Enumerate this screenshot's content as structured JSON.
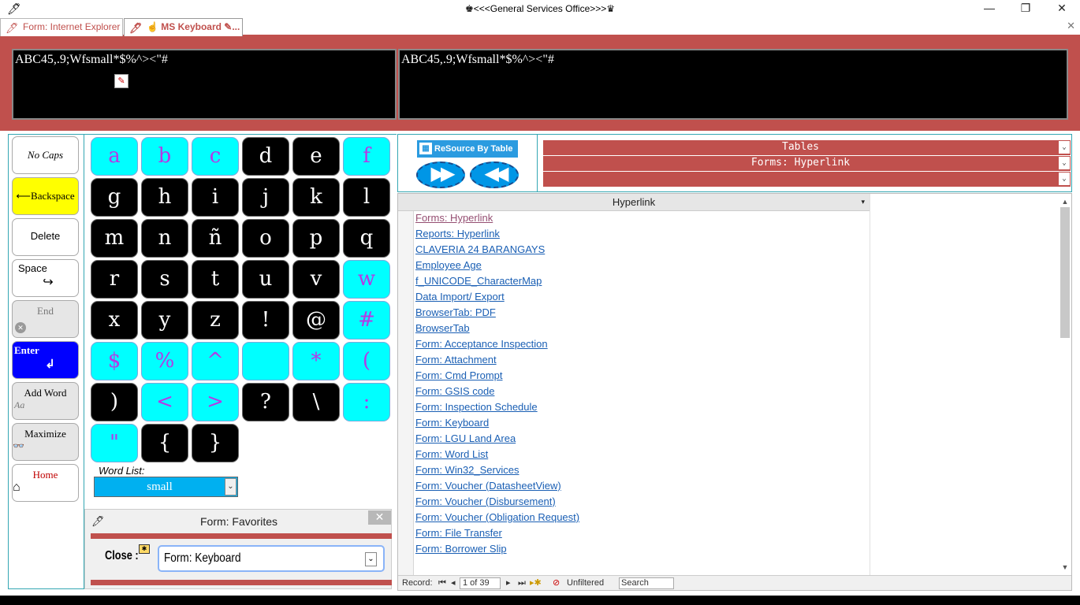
{
  "window": {
    "title": "♚<<<General Services Office>>>♛",
    "minimize": "—",
    "restore": "❐",
    "close": "✕"
  },
  "tabs": [
    {
      "label": "Form: Internet Explorer"
    },
    {
      "label": "☝ MS Keyboard ✎..."
    }
  ],
  "tab_close": "✕",
  "text_boxes": {
    "left": "ABC45,.9;Wfsmall*$%^><\"#",
    "right": "ABC45,.9;Wfsmall*$%^><\"#"
  },
  "side_buttons": {
    "no_caps": "No Caps",
    "backspace": "⟵Backspace",
    "delete": "Delete",
    "space": "Space",
    "space_glyph": "↪",
    "end": "End",
    "end_glyph": "✕",
    "enter": "Enter",
    "enter_glyph": "↲",
    "add_word": "Add Word",
    "add_word_sub": "Aa",
    "maximize": "Maximize",
    "maximize_glyph": "👓",
    "home": "Home",
    "home_glyph": "⌂"
  },
  "keys": [
    "a",
    "b",
    "c",
    "d",
    "e",
    "f",
    "g",
    "h",
    "i",
    "j",
    "k",
    "l",
    "m",
    "n",
    "ñ",
    "o",
    "p",
    "q",
    "r",
    "s",
    "t",
    "u",
    "v",
    "w",
    "x",
    "y",
    "z",
    "!",
    "@",
    "#",
    "$",
    "%",
    "^",
    "",
    "*",
    "(",
    ")",
    "<",
    ">",
    "?",
    "\\",
    ":",
    "\"",
    "{",
    "}"
  ],
  "key_styles": [
    "c",
    "c",
    "c",
    "b",
    "b",
    "c",
    "b",
    "b",
    "b",
    "b",
    "b",
    "b",
    "b",
    "b",
    "b",
    "b",
    "b",
    "b",
    "b",
    "b",
    "b",
    "b",
    "b",
    "c",
    "b",
    "b",
    "b",
    "b",
    "b",
    "c",
    "c",
    "c",
    "c",
    "c",
    "c",
    "c",
    "b",
    "c",
    "c",
    "b",
    "b",
    "c",
    "c",
    "b",
    "b"
  ],
  "word_list": {
    "label": "Word List:",
    "value": "small",
    "dropdown": "⌄"
  },
  "favorites": {
    "title": "Form: Favorites",
    "close_x": "✕",
    "close_label": "Close :",
    "value": "Form: Keyboard",
    "dropdown": "⌄"
  },
  "resource": {
    "button": "ReSource By Table",
    "forward": "▶▶",
    "back": "◀◀",
    "combo1": "Tables",
    "combo2": "Forms: Hyperlink",
    "combo3": "",
    "dropdown": "⌄"
  },
  "datasheet": {
    "header": "Hyperlink",
    "header_dd": "▾",
    "rows": [
      "Forms: Hyperlink",
      "Reports: Hyperlink",
      "CLAVERIA 24 BARANGAYS",
      "Employee Age",
      "f_UNICODE_CharacterMap",
      "Data Import/ Export",
      "BrowserTab: PDF",
      "BrowserTab",
      "Form: Acceptance Inspection",
      "Form: Attachment",
      "Form: Cmd Prompt",
      "Form: GSIS code",
      "Form: Inspection Schedule",
      "Form: Keyboard",
      "Form: LGU Land Area",
      "Form: Word List",
      "Form: Win32_Services",
      "Form: Voucher (DatasheetView)",
      "Form: Voucher (Disbursement)",
      "Form: Voucher (Obligation Request)",
      "Form: File Transfer",
      "Form: Borrower Slip"
    ]
  },
  "nav": {
    "record_label": "Record:",
    "first": "⏮",
    "prev": "◂",
    "position": "1 of 39",
    "next": "▸",
    "last": "⏭",
    "new": "▸✱",
    "filter": "Unfiltered",
    "search": "Search"
  },
  "colors": {
    "accent_red": "#c0504d",
    "key_cyan": "#00ffff",
    "key_glyph": "#b638e6",
    "enter_blue": "#0000ff",
    "backspace_yellow": "#ffff00",
    "link": "#1a5fb4"
  }
}
